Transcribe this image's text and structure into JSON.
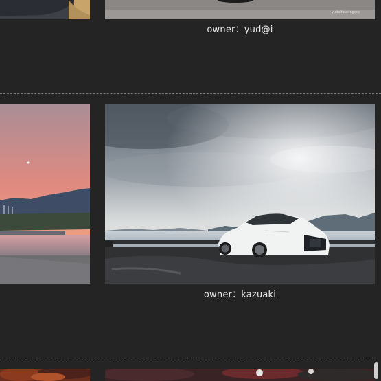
{
  "gallery": {
    "entries": [
      {
        "owner_label": "owner：yud@i",
        "watermark": "yudaihearingcoy"
      },
      {
        "owner_label": "owner：kazuaki"
      }
    ]
  },
  "colors": {
    "background": "#242424",
    "divider": "#7a7a7a",
    "caption_text": "#e8e8e8"
  }
}
